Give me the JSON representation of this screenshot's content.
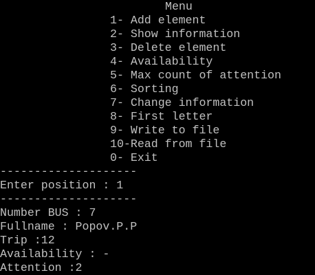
{
  "console": {
    "title": "Menu",
    "menu": [
      "1- Add element",
      "2- Show information",
      "3- Delete element",
      "4- Availability",
      "5- Max count of attention",
      "6- Sorting",
      "7- Change information",
      "8- First letter",
      "9- Write to file",
      "10-Read from file",
      "0- Exit"
    ],
    "separator": "--------------------",
    "prompt": "Enter position : 1",
    "record": {
      "bus_number": "Number BUS : 7",
      "fullname": "Fullname : Popov.P.P",
      "trip": "Trip :12",
      "availability": "Availability : -",
      "attention": "Attention :2"
    }
  },
  "colors": {
    "background": "#000000",
    "text": "#c0c0c0"
  }
}
